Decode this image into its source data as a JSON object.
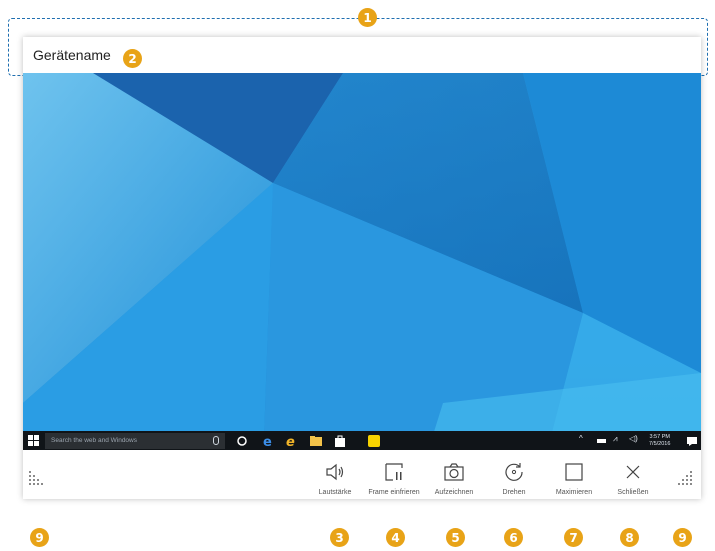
{
  "window": {
    "device_name": "Gerätename"
  },
  "callouts": [
    "1",
    "2",
    "3",
    "4",
    "5",
    "6",
    "7",
    "8",
    "9",
    "9"
  ],
  "taskbar": {
    "search_placeholder": "Search the web and Windows",
    "time": "3:57 PM",
    "date": "7/5/2016"
  },
  "controls": [
    {
      "label": "Lautstärke",
      "icon": "speaker-icon"
    },
    {
      "label": "Frame einfrieren",
      "icon": "freeze-frame-icon"
    },
    {
      "label": "Aufzeichnen",
      "icon": "camera-icon"
    },
    {
      "label": "Drehen",
      "icon": "rotate-icon"
    },
    {
      "label": "Maximieren",
      "icon": "maximize-icon"
    },
    {
      "label": "Schließen",
      "icon": "close-icon"
    }
  ],
  "colors": {
    "accent_dashed": "#1f6fb0",
    "badge": "#e8a317",
    "desktop_blue": "#1a8fd6",
    "taskbar": "#101418"
  }
}
